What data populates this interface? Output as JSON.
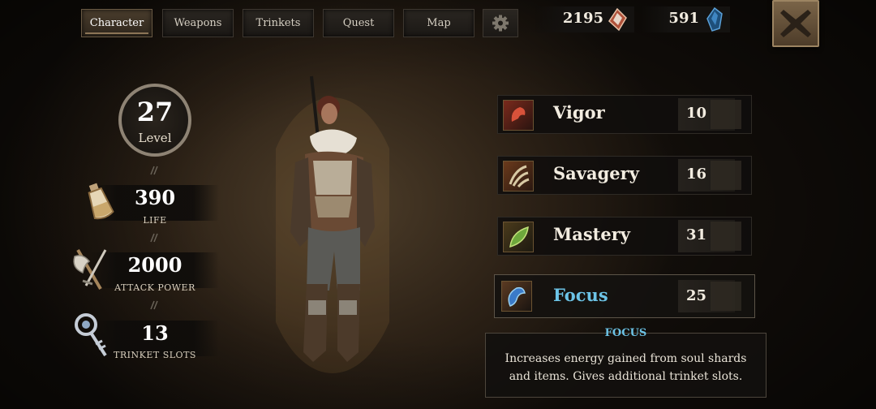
{
  "tabs": [
    {
      "label": "Character",
      "active": true
    },
    {
      "label": "Weapons",
      "active": false
    },
    {
      "label": "Trinkets",
      "active": false
    },
    {
      "label": "Quest",
      "active": false
    },
    {
      "label": "Map",
      "active": false
    }
  ],
  "settings_icon": "gear-icon",
  "currency": {
    "souls": {
      "value": "2195",
      "icon": "soul-shard-icon"
    },
    "gems": {
      "value": "591",
      "icon": "blue-gem-icon"
    }
  },
  "close_icon": "close-x-icon",
  "level": {
    "number": "27",
    "label": "Level"
  },
  "stats": [
    {
      "value": "390",
      "label": "LIFE",
      "icon": "potion-icon"
    },
    {
      "value": "2000",
      "label": "ATTACK POWER",
      "icon": "axe-sword-icon"
    },
    {
      "value": "13",
      "label": "TRINKET SLOTS",
      "icon": "trinket-icon"
    }
  ],
  "attributes": [
    {
      "name": "Vigor",
      "value": "10",
      "icon": "vigor-icon",
      "selected": false
    },
    {
      "name": "Savagery",
      "value": "16",
      "icon": "savagery-claw-icon",
      "selected": false
    },
    {
      "name": "Mastery",
      "value": "31",
      "icon": "mastery-leaf-icon",
      "selected": false
    },
    {
      "name": "Focus",
      "value": "25",
      "icon": "focus-icon",
      "selected": true
    }
  ],
  "description": {
    "title": "FOCUS",
    "text": "Increases energy gained from soul shards and items. Gives additional trinket slots."
  },
  "colors": {
    "accent_selected": "#6cc3e6",
    "gold": "#9c8462"
  }
}
